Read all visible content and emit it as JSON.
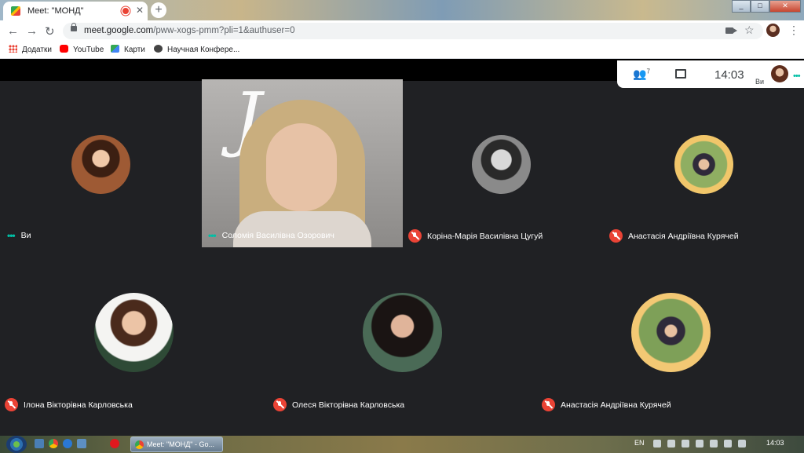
{
  "browser": {
    "tab_title": "Meet: \"МОНД\"",
    "close_glyph": "✕",
    "new_tab_glyph": "+",
    "window_buttons": [
      "_",
      "□",
      "✕"
    ],
    "back_glyph": "←",
    "forward_glyph": "→",
    "reload_glyph": "↻",
    "url_host": "meet.google.com",
    "url_path": "/pww-xogs-pmm?pli=1&authuser=0",
    "star_glyph": "☆",
    "menu_glyph": "⋮"
  },
  "bookmarks": [
    {
      "label": "Додатки",
      "icon": "apps-icon"
    },
    {
      "label": "YouTube",
      "icon": "youtube-icon"
    },
    {
      "label": "Карти",
      "icon": "maps-icon"
    },
    {
      "label": "Научная Конфере...",
      "icon": "page-icon"
    }
  ],
  "meet": {
    "participants_count": "7",
    "people_glyph": "👥",
    "time": "14:03",
    "self_label": "Ви",
    "speaking_glyph": "•••",
    "tiles": [
      {
        "name": "Ви",
        "muted": false,
        "speaking": true
      },
      {
        "name": "Соломія Василівна Озорович",
        "muted": false,
        "speaking": true
      },
      {
        "name": "Коріна-Марія Василівна Цугуй",
        "muted": true,
        "speaking": false
      },
      {
        "name": "Анастасія Андріївна Курячей",
        "muted": true,
        "speaking": false
      },
      {
        "name": "Ілона Вікторівна Карловська",
        "muted": true,
        "speaking": false
      },
      {
        "name": "Олеся Вікторівна Карловська",
        "muted": true,
        "speaking": false
      },
      {
        "name": "Анастасія Андріївна Курячей",
        "muted": true,
        "speaking": false
      }
    ]
  },
  "taskbar": {
    "task_label": "Meet: \"МОНД\" - Go...",
    "language": "EN",
    "clock": "14:03"
  }
}
